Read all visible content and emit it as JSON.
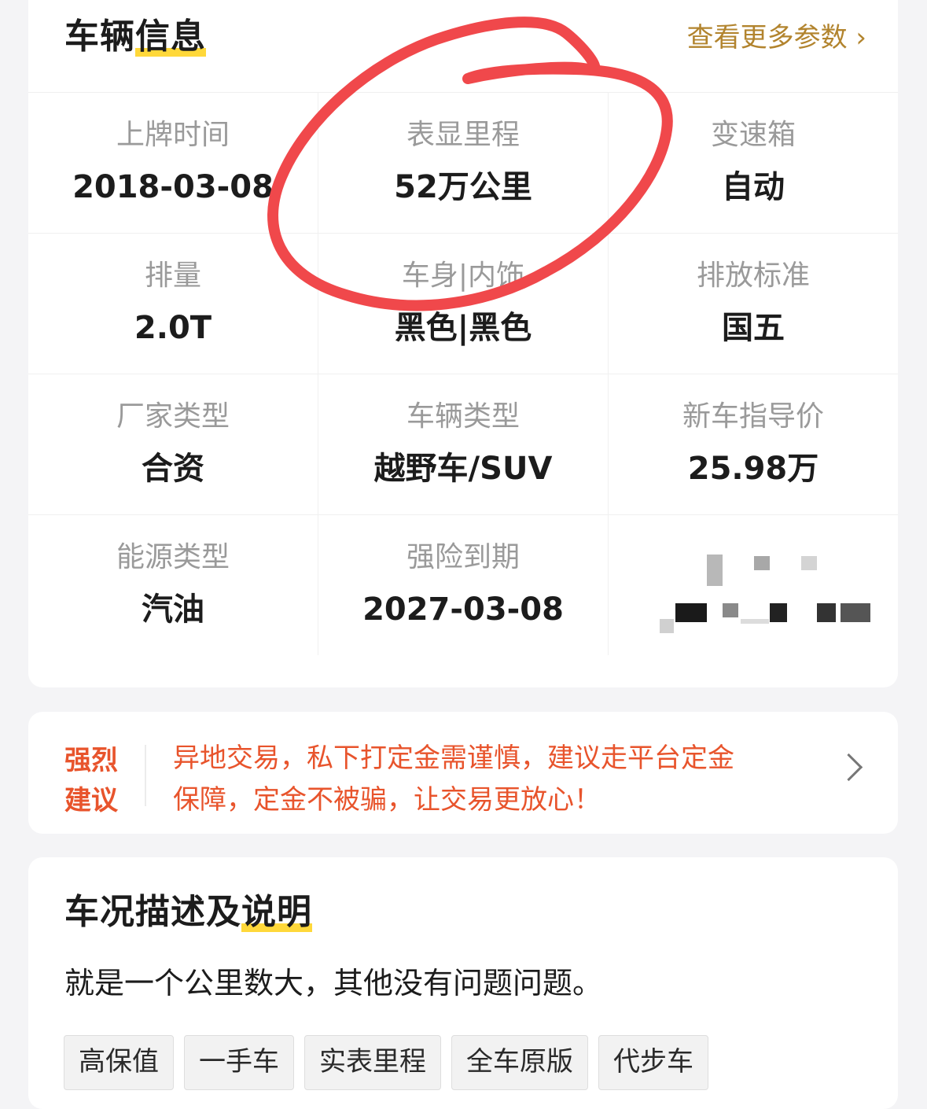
{
  "vehicle_info": {
    "title_plain": "车辆",
    "title_highlight": "信息",
    "more_link": "查看更多参数",
    "more_chevron": "›",
    "rows": [
      [
        {
          "label": "上牌时间",
          "value": "2018-03-08"
        },
        {
          "label": "表显里程",
          "value": "52万公里"
        },
        {
          "label": "变速箱",
          "value": "自动"
        }
      ],
      [
        {
          "label": "排量",
          "value": "2.0T"
        },
        {
          "label": "车身|内饰",
          "value": "黑色|黑色"
        },
        {
          "label": "排放标准",
          "value": "国五"
        }
      ],
      [
        {
          "label": "厂家类型",
          "value": "合资"
        },
        {
          "label": "车辆类型",
          "value": "越野车/SUV"
        },
        {
          "label": "新车指导价",
          "value": "25.98万"
        }
      ],
      [
        {
          "label": "能源类型",
          "value": "汽油"
        },
        {
          "label": "强险到期",
          "value": "2027-03-08"
        }
      ]
    ],
    "annotation_color": "#f0484b"
  },
  "notice": {
    "tag_line1": "强烈",
    "tag_line2": "建议",
    "text_line1": "异地交易，私下打定金需谨慎，建议走平台定金",
    "text_line2": "保障，定金不被骗，让交易更放心！",
    "accent_color": "#e8542c",
    "chevron_icon": "chevron-right-icon"
  },
  "condition": {
    "title_plain": "车况描述及",
    "title_highlight": "说明",
    "description": "就是一个公里数大，其他没有问题问题。",
    "tags": [
      "高保值",
      "一手车",
      "实表里程",
      "全车原版",
      "代步车"
    ]
  }
}
